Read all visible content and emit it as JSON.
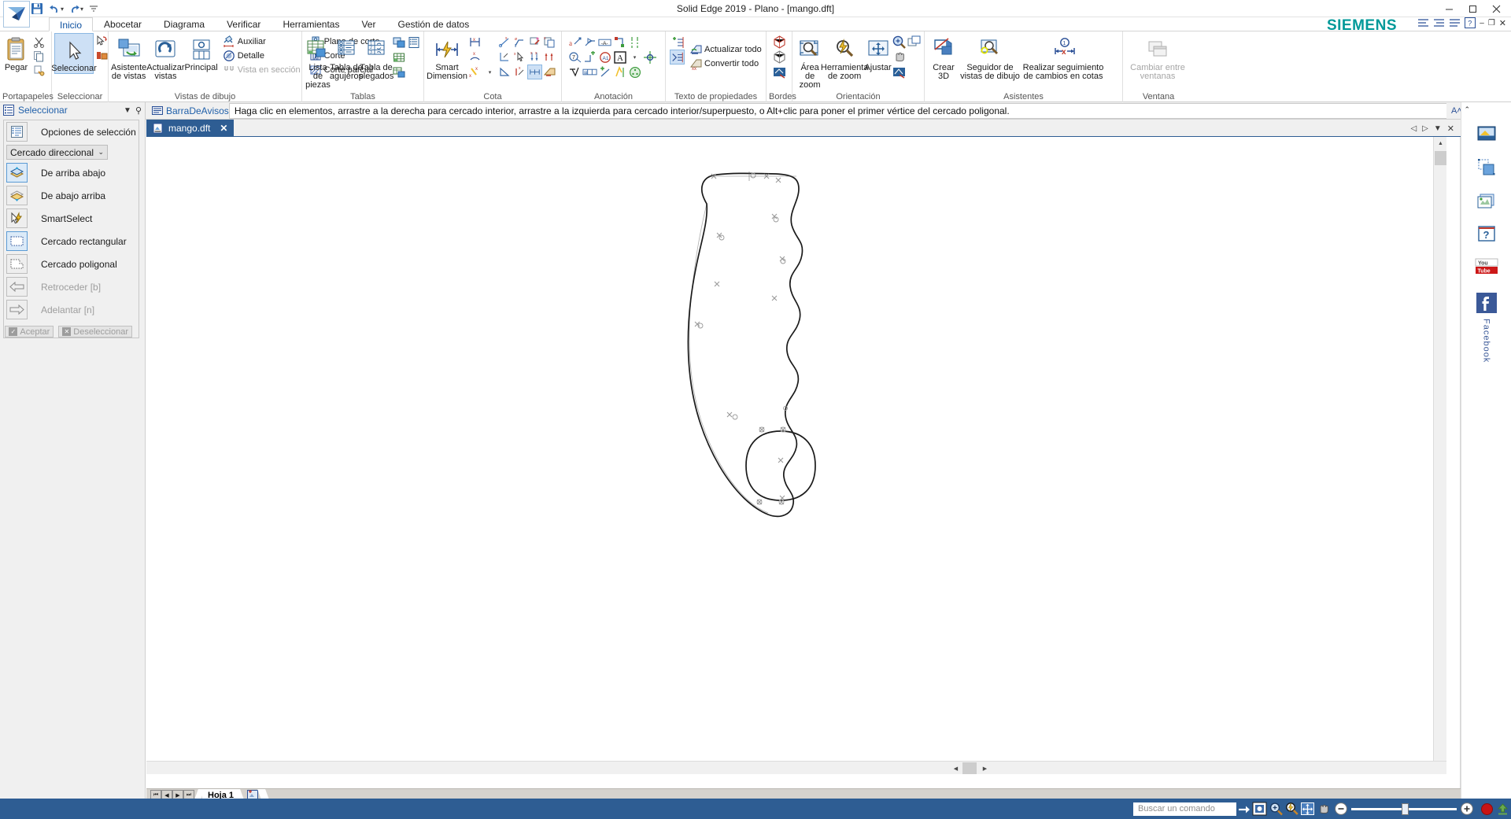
{
  "window": {
    "title": "Solid Edge 2019 - Plano - [mango.dft]",
    "minimize": "–",
    "maximize": "□",
    "close": "✕",
    "brand": "SIEMENS",
    "quick_access": [
      "save-icon",
      "undo-icon",
      "redo-icon",
      "customize-qat-icon"
    ]
  },
  "ribbon": {
    "tabs": [
      {
        "label": "Inicio",
        "active": true
      },
      {
        "label": "Abocetar",
        "active": false
      },
      {
        "label": "Diagrama",
        "active": false
      },
      {
        "label": "Verificar",
        "active": false
      },
      {
        "label": "Herramientas",
        "active": false
      },
      {
        "label": "Ver",
        "active": false
      },
      {
        "label": "Gestión de datos",
        "active": false
      }
    ],
    "groups": [
      {
        "name": "Portapapeles",
        "label": "Portapapeles",
        "big": [
          {
            "label": "Pegar",
            "icon": "paste-icon"
          }
        ],
        "small": [
          {
            "label": "",
            "icon": "cut-icon"
          },
          {
            "label": "",
            "icon": "copy-icon"
          },
          {
            "label": "",
            "icon": "copy-format-icon"
          }
        ]
      },
      {
        "name": "Seleccionar",
        "label": "Seleccionar",
        "big": [
          {
            "label": "Seleccionar",
            "icon": "select-arrow-icon",
            "selected": true
          }
        ],
        "small": [
          {
            "label": "",
            "icon": "select-similar-icon"
          },
          {
            "label": "",
            "icon": "select-part-icon"
          }
        ]
      },
      {
        "name": "Vistas de dibujo",
        "label": "Vistas de dibujo",
        "big": [
          {
            "label": "Asistente de vistas",
            "icon": "view-wizard-icon"
          },
          {
            "label": "Actualizar vistas",
            "icon": "update-views-icon"
          },
          {
            "label": "Principal",
            "icon": "principal-view-icon"
          }
        ],
        "small": [
          {
            "label": "Auxiliar",
            "icon": "auxiliary-view-icon",
            "disabled": false
          },
          {
            "label": "Detalle",
            "icon": "detail-view-icon",
            "disabled": false
          },
          {
            "label": "Vista en sección",
            "icon": "section-view-icon",
            "disabled": true
          },
          {
            "label": "Plano de corte",
            "icon": "cutting-plane-icon",
            "disabled": false
          },
          {
            "label": "Corte",
            "icon": "broken-view-icon",
            "disabled": false
          },
          {
            "label": "Corte parcial",
            "icon": "partial-cut-icon",
            "disabled": false
          }
        ]
      },
      {
        "name": "Tablas",
        "label": "Tablas",
        "big": [
          {
            "label": "Lista de piezas",
            "icon": "parts-list-icon"
          },
          {
            "label": "Tabla de agujeros",
            "icon": "hole-table-icon"
          },
          {
            "label": "Tabla de plegados",
            "icon": "bend-table-icon"
          }
        ],
        "small": [
          {
            "label": "",
            "icon": "family-table-icon"
          },
          {
            "label": "",
            "icon": "list-table-icon"
          },
          {
            "label": "",
            "icon": "grid-table-icon"
          },
          {
            "label": "",
            "icon": "add-table-icon"
          }
        ]
      },
      {
        "name": "Cota",
        "label": "Cota",
        "big": [
          {
            "label": "Smart Dimension",
            "icon": "smart-dimension-icon"
          }
        ],
        "small": []
      },
      {
        "name": "Anotación",
        "label": "Anotación",
        "big": [],
        "small": []
      },
      {
        "name": "Texto de propiedades",
        "label": "Texto de propiedades",
        "big": [],
        "small": [
          {
            "label": "Actualizar todo",
            "icon": "update-all-icon"
          },
          {
            "label": "Convertir todo",
            "icon": "convert-all-icon"
          }
        ]
      },
      {
        "name": "Bordes",
        "label": "Bordes",
        "big": [],
        "small": []
      },
      {
        "name": "Orientación",
        "label": "Orientación",
        "big": [
          {
            "label": "Área de zoom",
            "icon": "zoom-area-icon"
          },
          {
            "label": "Herramienta de zoom",
            "icon": "zoom-tool-icon"
          },
          {
            "label": "Ajustar",
            "icon": "fit-icon"
          }
        ],
        "small": [
          {
            "label": "",
            "icon": "zoom-in-out-icon"
          },
          {
            "label": "",
            "icon": "window-switch-icon"
          },
          {
            "label": "",
            "icon": "pan-icon"
          },
          {
            "label": "",
            "icon": "paint-view-icon"
          }
        ]
      },
      {
        "name": "Asistentes",
        "label": "Asistentes",
        "big": [
          {
            "label": "Crear 3D",
            "icon": "create-3d-icon"
          },
          {
            "label": "Seguidor de vistas de dibujo",
            "icon": "drawing-view-tracker-icon"
          },
          {
            "label": "Realizar seguimiento de cambios en cotas",
            "icon": "dimension-change-tracker-icon"
          }
        ],
        "small": []
      },
      {
        "name": "Ventana",
        "label": "Ventana",
        "big": [
          {
            "label": "Cambiar entre ventanas",
            "icon": "switch-windows-icon",
            "disabled": true
          }
        ],
        "small": []
      }
    ]
  },
  "prompt_bar": {
    "tag": "BarraDeAvisos",
    "message": "Haga clic en elementos, arrastre a la derecha para cercado interior, arrastre a la izquierda para cercado interior/superpuesto, o Alt+clic para poner el primer vértice del cercado poligonal.",
    "right_icons": [
      "font-grow-icon",
      "font-shrink-icon",
      "collapse-icon",
      "dropdown-icon",
      "pin-icon",
      "close-icon"
    ]
  },
  "left_panel": {
    "title": "Seleccionar",
    "title_icon": "select-panel-icon",
    "dropdown_icon": "chevron-down-icon",
    "pin_icon": "pin-icon",
    "options_row": {
      "label": "Opciones de selección",
      "icon": "selection-options-icon"
    },
    "mode_select": {
      "value": "Cercado direccional",
      "chevron": "⌄"
    },
    "items": [
      {
        "label": "De arriba abajo",
        "icon": "top-down-icon",
        "active": true,
        "disabled": false
      },
      {
        "label": "De abajo arriba",
        "icon": "bottom-up-icon",
        "active": false,
        "disabled": false
      },
      {
        "label": "SmartSelect",
        "icon": "smartselect-icon",
        "active": false,
        "disabled": false
      },
      {
        "label": "Cercado rectangular",
        "icon": "rect-fence-icon",
        "active": true,
        "disabled": false
      },
      {
        "label": "Cercado poligonal",
        "icon": "poly-fence-icon",
        "active": false,
        "disabled": false
      },
      {
        "label": "Retroceder [b]",
        "icon": "back-arrow-icon",
        "active": false,
        "disabled": true
      },
      {
        "label": "Adelantar [n]",
        "icon": "forward-arrow-icon",
        "active": false,
        "disabled": true
      }
    ],
    "buttons": [
      {
        "label": "Aceptar",
        "icon": "check-icon",
        "disabled": true
      },
      {
        "label": "Deseleccionar",
        "icon": "x-icon",
        "disabled": true
      }
    ]
  },
  "document": {
    "tab": {
      "label": "mango.dft",
      "icon": "dft-file-icon",
      "close": "✕"
    },
    "tab_right_icons": [
      "prev-icon",
      "next-icon",
      "dropdown-icon",
      "close-icon"
    ]
  },
  "right_bar": {
    "icons": [
      "layers-panel-icon",
      "copy-stack-icon",
      "library-icon",
      "help-icon",
      "youtube-icon",
      "facebook-icon"
    ],
    "facebook_label": "Facebook"
  },
  "sheet_bar": {
    "nav": [
      "⏮",
      "◀",
      "▶",
      "⏭"
    ],
    "sheets": [
      {
        "label": "Hoja 1",
        "active": true
      }
    ],
    "add_sheet_icon": "add-sheet-icon"
  },
  "status_bar": {
    "search_placeholder": "Buscar un comando",
    "icons": [
      "go-arrow-icon",
      "fit-window-icon",
      "zoom-area-icon",
      "zoom-tool-icon",
      "fit-icon",
      "pan-icon"
    ],
    "zoom": {
      "minus": "–",
      "plus": "+",
      "value": 50
    },
    "record_icon": "record-icon",
    "upload-icon": "upload-icon"
  },
  "colors": {
    "accent": "#2e5d93",
    "ribbon_bg": "#ffffff",
    "panel_bg": "#f0f0f0",
    "canvas_bg": "#ffffff",
    "siemens": "#009999",
    "tab_active_text": "#0b4f9e",
    "link": "#1f5fa9",
    "geometry_stroke": "#1a1a1a"
  },
  "drawing": {
    "name": "mango-profile-drawing",
    "shapes": [
      "handle-outline-spline",
      "circle-outline"
    ]
  }
}
